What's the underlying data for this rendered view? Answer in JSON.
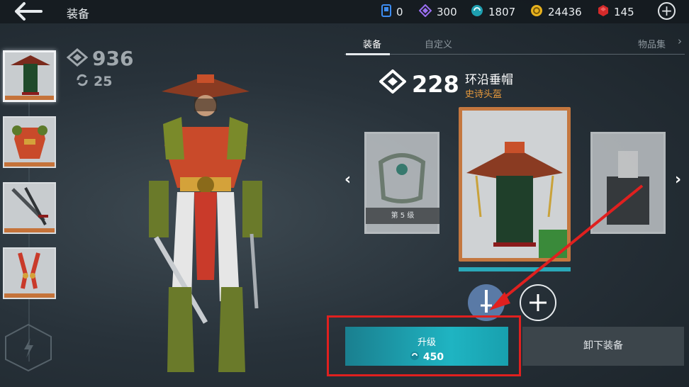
{
  "header": {
    "title": "装备",
    "currencies": [
      {
        "icon": "blue-card-icon",
        "value": "0"
      },
      {
        "icon": "purple-gem-icon",
        "value": "300"
      },
      {
        "icon": "teal-orb-icon",
        "value": "1807"
      },
      {
        "icon": "gold-coin-icon",
        "value": "24436"
      },
      {
        "icon": "red-ruby-icon",
        "value": "145"
      }
    ]
  },
  "stats": {
    "power": "936",
    "level": "25"
  },
  "tabs": [
    {
      "label": "装备",
      "active": true
    },
    {
      "label": "自定义",
      "active": false
    },
    {
      "label": "物品集",
      "active": false
    }
  ],
  "item": {
    "power": "228",
    "name": "环沿垂帽",
    "type": "史诗头盔",
    "left_card_tier": "第 5 级"
  },
  "actions": {
    "upgrade_label": "升级",
    "upgrade_cost": "450",
    "unequip_label": "卸下装备"
  },
  "colors": {
    "accent": "#1fb4c2",
    "epic": "#c4773f",
    "highlight": "#e0201f",
    "type_text": "#e89a3c"
  }
}
